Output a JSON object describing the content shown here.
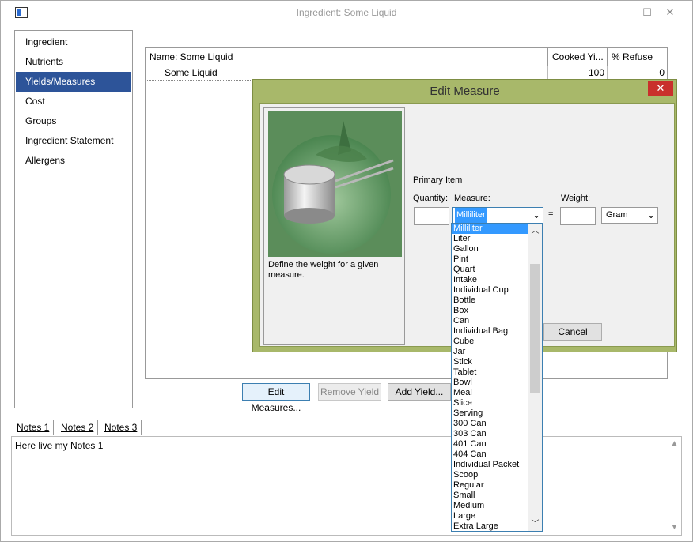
{
  "window": {
    "title": "Ingredient: Some Liquid",
    "minimize": "—",
    "maximize": "☐",
    "close": "✕"
  },
  "sidebar": {
    "items": [
      {
        "label": "Ingredient"
      },
      {
        "label": "Nutrients"
      },
      {
        "label": "Yields/Measures",
        "selected": true
      },
      {
        "label": "Cost"
      },
      {
        "label": "Groups"
      },
      {
        "label": "Ingredient Statement"
      },
      {
        "label": "Allergens"
      }
    ]
  },
  "grid": {
    "columns": [
      "Name: Some Liquid",
      "Cooked Yi...",
      "% Refuse"
    ],
    "rows": [
      {
        "name": "Some Liquid",
        "cooked_yield": "100",
        "refuse": "0"
      }
    ]
  },
  "buttons": {
    "edit_measures": "Edit Measures...",
    "remove_yield": "Remove Yield",
    "add_yield": "Add Yield..."
  },
  "notes": {
    "tabs": [
      "Notes 1",
      "Notes 2",
      "Notes 3"
    ],
    "text": "Here live my Notes 1"
  },
  "dialog": {
    "title": "Edit Measure",
    "close": "✕",
    "info_text": "Define the weight for a given measure.",
    "primary_item_label": "Primary Item",
    "quantity_label": "Quantity:",
    "measure_label": "Measure:",
    "weight_label": "Weight:",
    "equals": "=",
    "quantity_value": "",
    "measure_value": "Milliliter",
    "weight_value": "",
    "weight_unit": "Gram",
    "cancel": "Cancel"
  },
  "measure_options": [
    "Milliliter",
    "Liter",
    "Gallon",
    "Pint",
    "Quart",
    "Intake",
    "Individual Cup",
    "Bottle",
    "Box",
    "Can",
    "Individual Bag",
    "Cube",
    "Jar",
    "Stick",
    "Tablet",
    "Bowl",
    "Meal",
    "Slice",
    "Serving",
    "300 Can",
    "303 Can",
    "401 Can",
    "404 Can",
    "Individual Packet",
    "Scoop",
    "Regular",
    "Small",
    "Medium",
    "Large",
    "Extra Large"
  ],
  "colors": {
    "selection": "#2d5499",
    "highlight": "#3399ff",
    "dialog_frame": "#a8b86a",
    "close_red": "#c9302c"
  }
}
